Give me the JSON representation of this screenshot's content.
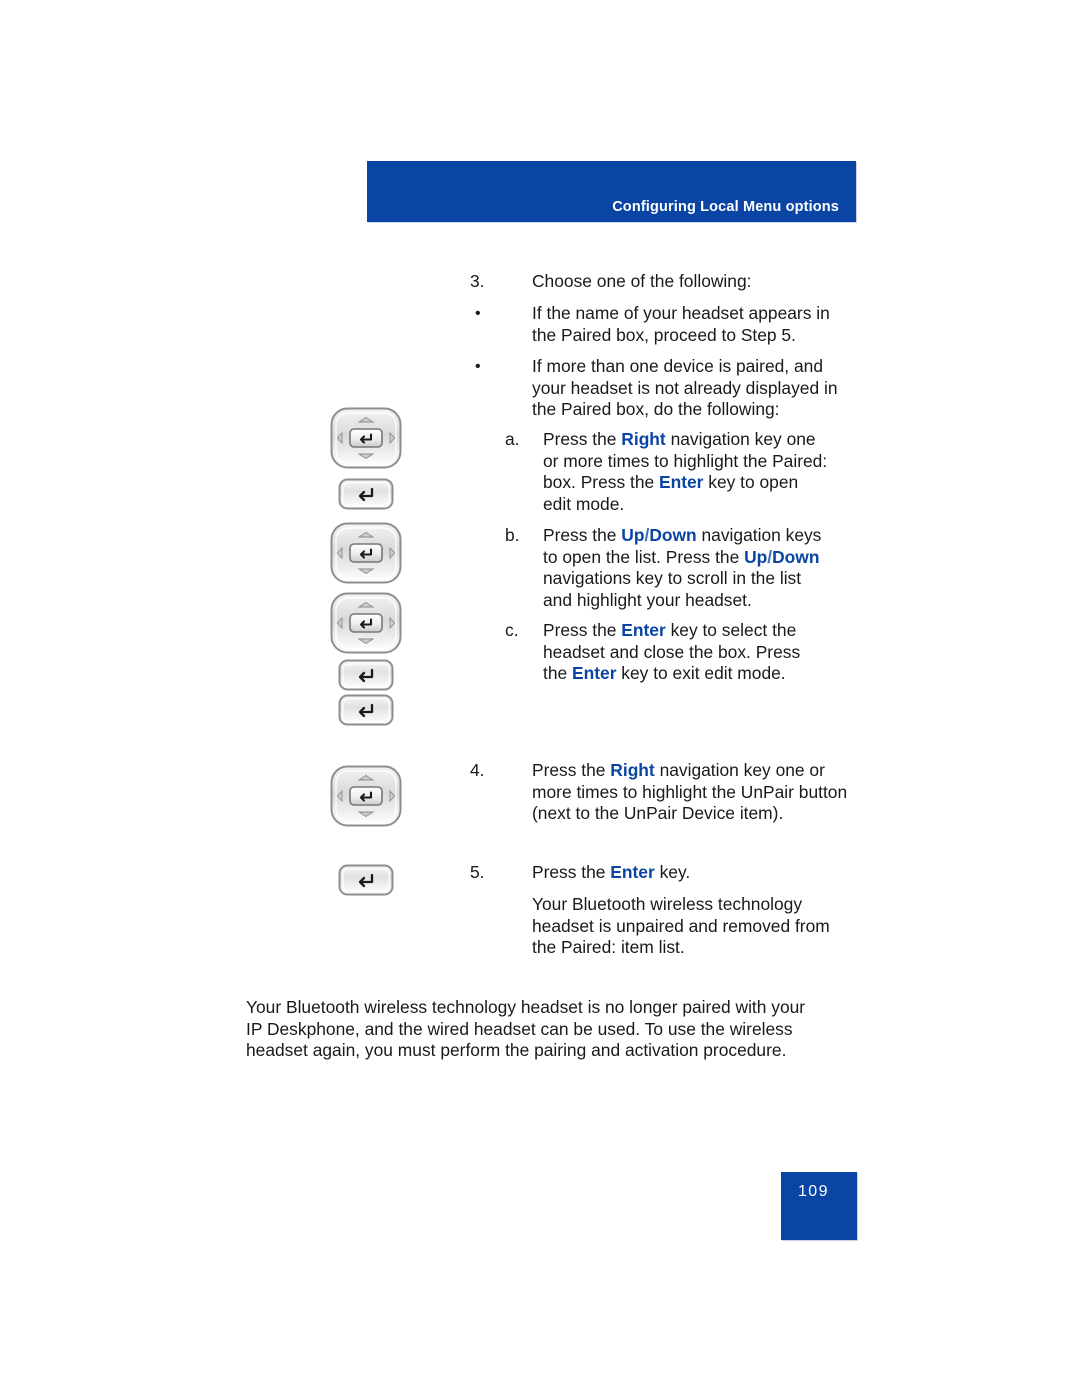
{
  "page": {
    "header_title": "Configuring Local Menu options",
    "page_number": "109",
    "accent_blue": "#0a45a5",
    "text_color": "#1a1a1a"
  },
  "steps": [
    {
      "number": "3.",
      "text": "Choose one of the following:"
    }
  ],
  "bullets": [
    {
      "marker": "•",
      "line1": "If the name of your headset appears in",
      "line2": "the Paired box, proceed to Step 5."
    },
    {
      "marker": "•",
      "line1": "If more than one device is paired, and",
      "line2": "your headset is not already displayed in",
      "line3": "the Paired box, do the following:"
    }
  ],
  "substeps": [
    {
      "letter": "a.",
      "seg": [
        {
          "t": "Press the ",
          "s": "plain"
        },
        {
          "t": "Right",
          "s": "kw"
        },
        {
          "t": " navigation key one or more times to highlight the Paired: box. Press the ",
          "s": "plain"
        },
        {
          "t": "Enter",
          "s": "kw"
        },
        {
          "t": " key to open edit mode.",
          "s": "plain"
        }
      ],
      "lines": [
        "Press the Right navigation key one",
        "or more times to highlight the Paired:",
        "box. Press the Enter key to open",
        "edit mode."
      ]
    },
    {
      "letter": "b.",
      "lines": [
        "Press the Up/Down navigation keys",
        "to open the list. Press the Up/Down",
        "navigations key to scroll in the list",
        "and highlight your headset."
      ]
    },
    {
      "letter": "c.",
      "lines": [
        "Press the Enter key to select the",
        "headset and close the box. Press",
        "the Enter key to exit edit mode."
      ]
    }
  ],
  "step4": {
    "number": "4.",
    "pre": "Press the ",
    "keyword": "Right",
    "post_line1": " navigation key one or",
    "line2": "more times to highlight the UnPair button",
    "line3": "(next to the UnPair Device item)."
  },
  "step5": {
    "number": "5.",
    "pre": "Press the ",
    "keyword": "Enter",
    "post": " key.",
    "body_line1": "Your Bluetooth wireless technology",
    "body_line2": "headset is unpaired and removed from",
    "body_line3": "the Paired: item list."
  },
  "closing_paragraph": {
    "line1": "Your Bluetooth wireless technology headset is no longer paired with your",
    "line2": "IP Deskphone, and the wired headset can be used. To use the wireless",
    "line3": "headset again, you must perform the pairing and activation procedure."
  },
  "substep_a": {
    "l1_pre": "Press the ",
    "l1_kw": "Right",
    "l1_post": " navigation key one",
    "l2": "or more times to highlight the Paired:",
    "l3_pre": "box. Press the ",
    "l3_kw": "Enter",
    "l3_post": " key to open",
    "l4": "edit mode."
  },
  "substep_b": {
    "l1_pre": "Press the ",
    "l1_kw_up": "Up",
    "l1_kw_slash": "/",
    "l1_kw_down": "Down",
    "l1_post": " navigation keys",
    "l2_pre": "to open the list. Press the ",
    "l2_kw_up": "Up",
    "l2_kw_slash": "/",
    "l2_kw_down": "Down",
    "l3": "navigations key to scroll in the list",
    "l4": "and highlight your headset."
  },
  "substep_c": {
    "l1_pre": "Press the ",
    "l1_kw": "Enter",
    "l1_post": " key to select the",
    "l2": "headset and close the box. Press",
    "l3_pre": "the ",
    "l3_kw": "Enter",
    "l3_post": " key to exit edit mode."
  },
  "icons": [
    {
      "name": "navigation-cluster-icon",
      "label": "navigation key cluster"
    },
    {
      "name": "enter-key-icon",
      "label": "Enter key"
    }
  ]
}
